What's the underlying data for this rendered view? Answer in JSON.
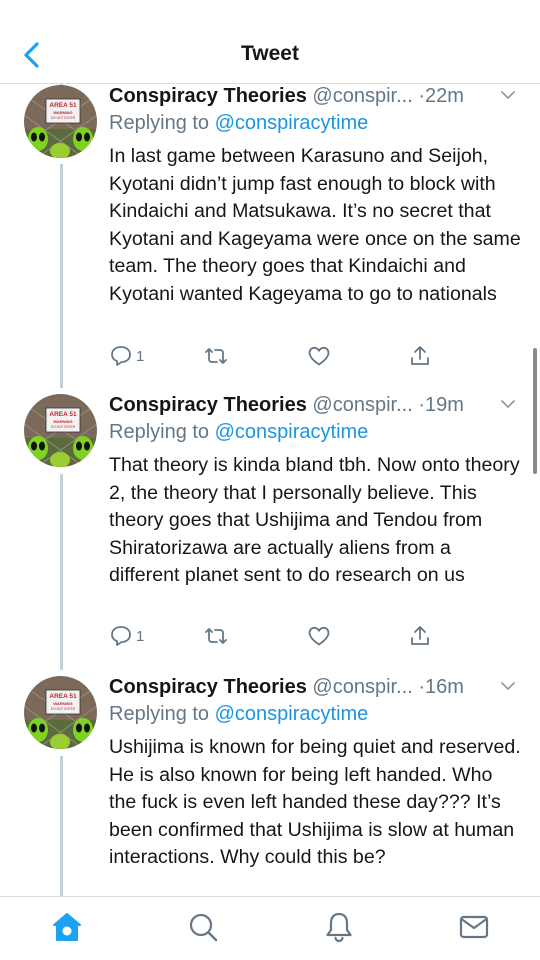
{
  "header": {
    "title": "Tweet"
  },
  "colors": {
    "accent": "#1da1f2",
    "secondary_text": "#657786",
    "thread_line": "#c4cfd6"
  },
  "tweets": [
    {
      "name": "Conspiracy Theories",
      "handle": "@conspir...",
      "time": "·22m",
      "reply_prefix": "Replying to",
      "reply_to": "@conspiracytime",
      "text": "In last game between Karasuno and Seijoh, Kyotani didn’t jump fast enough to block with Kindaichi and Matsukawa. It’s no secret that Kyotani and Kageyama were once on the same team. The theory goes that Kindaichi and Kyotani wanted Kageyama to go to nationals",
      "reply_count": "1"
    },
    {
      "name": "Conspiracy Theories",
      "handle": "@conspir...",
      "time": "·19m",
      "reply_prefix": "Replying to",
      "reply_to": "@conspiracytime",
      "text": "That theory is kinda bland tbh. Now onto theory 2, the theory that I personally believe. This theory goes that Ushijima and Tendou from Shiratorizawa are actually aliens from a different planet sent to do research on us",
      "reply_count": "1"
    },
    {
      "name": "Conspiracy Theories",
      "handle": "@conspir...",
      "time": "·16m",
      "reply_prefix": "Replying to",
      "reply_to": "@conspiracytime",
      "text": "Ushijima is known for being quiet and reserved. He is also known for being left handed. Who the fuck is even left handed these day??? It’s been confirmed that Ushijima is slow at human interactions. Why could this be?"
    }
  ],
  "avatar": {
    "sign_line1": "AREA 51",
    "sign_line2": "WARNING",
    "sign_line3": "DO NOT ENTER"
  },
  "icons": {
    "back": "chevron-left-icon",
    "reply": "reply-icon",
    "retweet": "retweet-icon",
    "like": "heart-icon",
    "share": "share-icon",
    "home": "home-icon",
    "search": "search-icon",
    "notifications": "bell-icon",
    "messages": "mail-icon"
  }
}
